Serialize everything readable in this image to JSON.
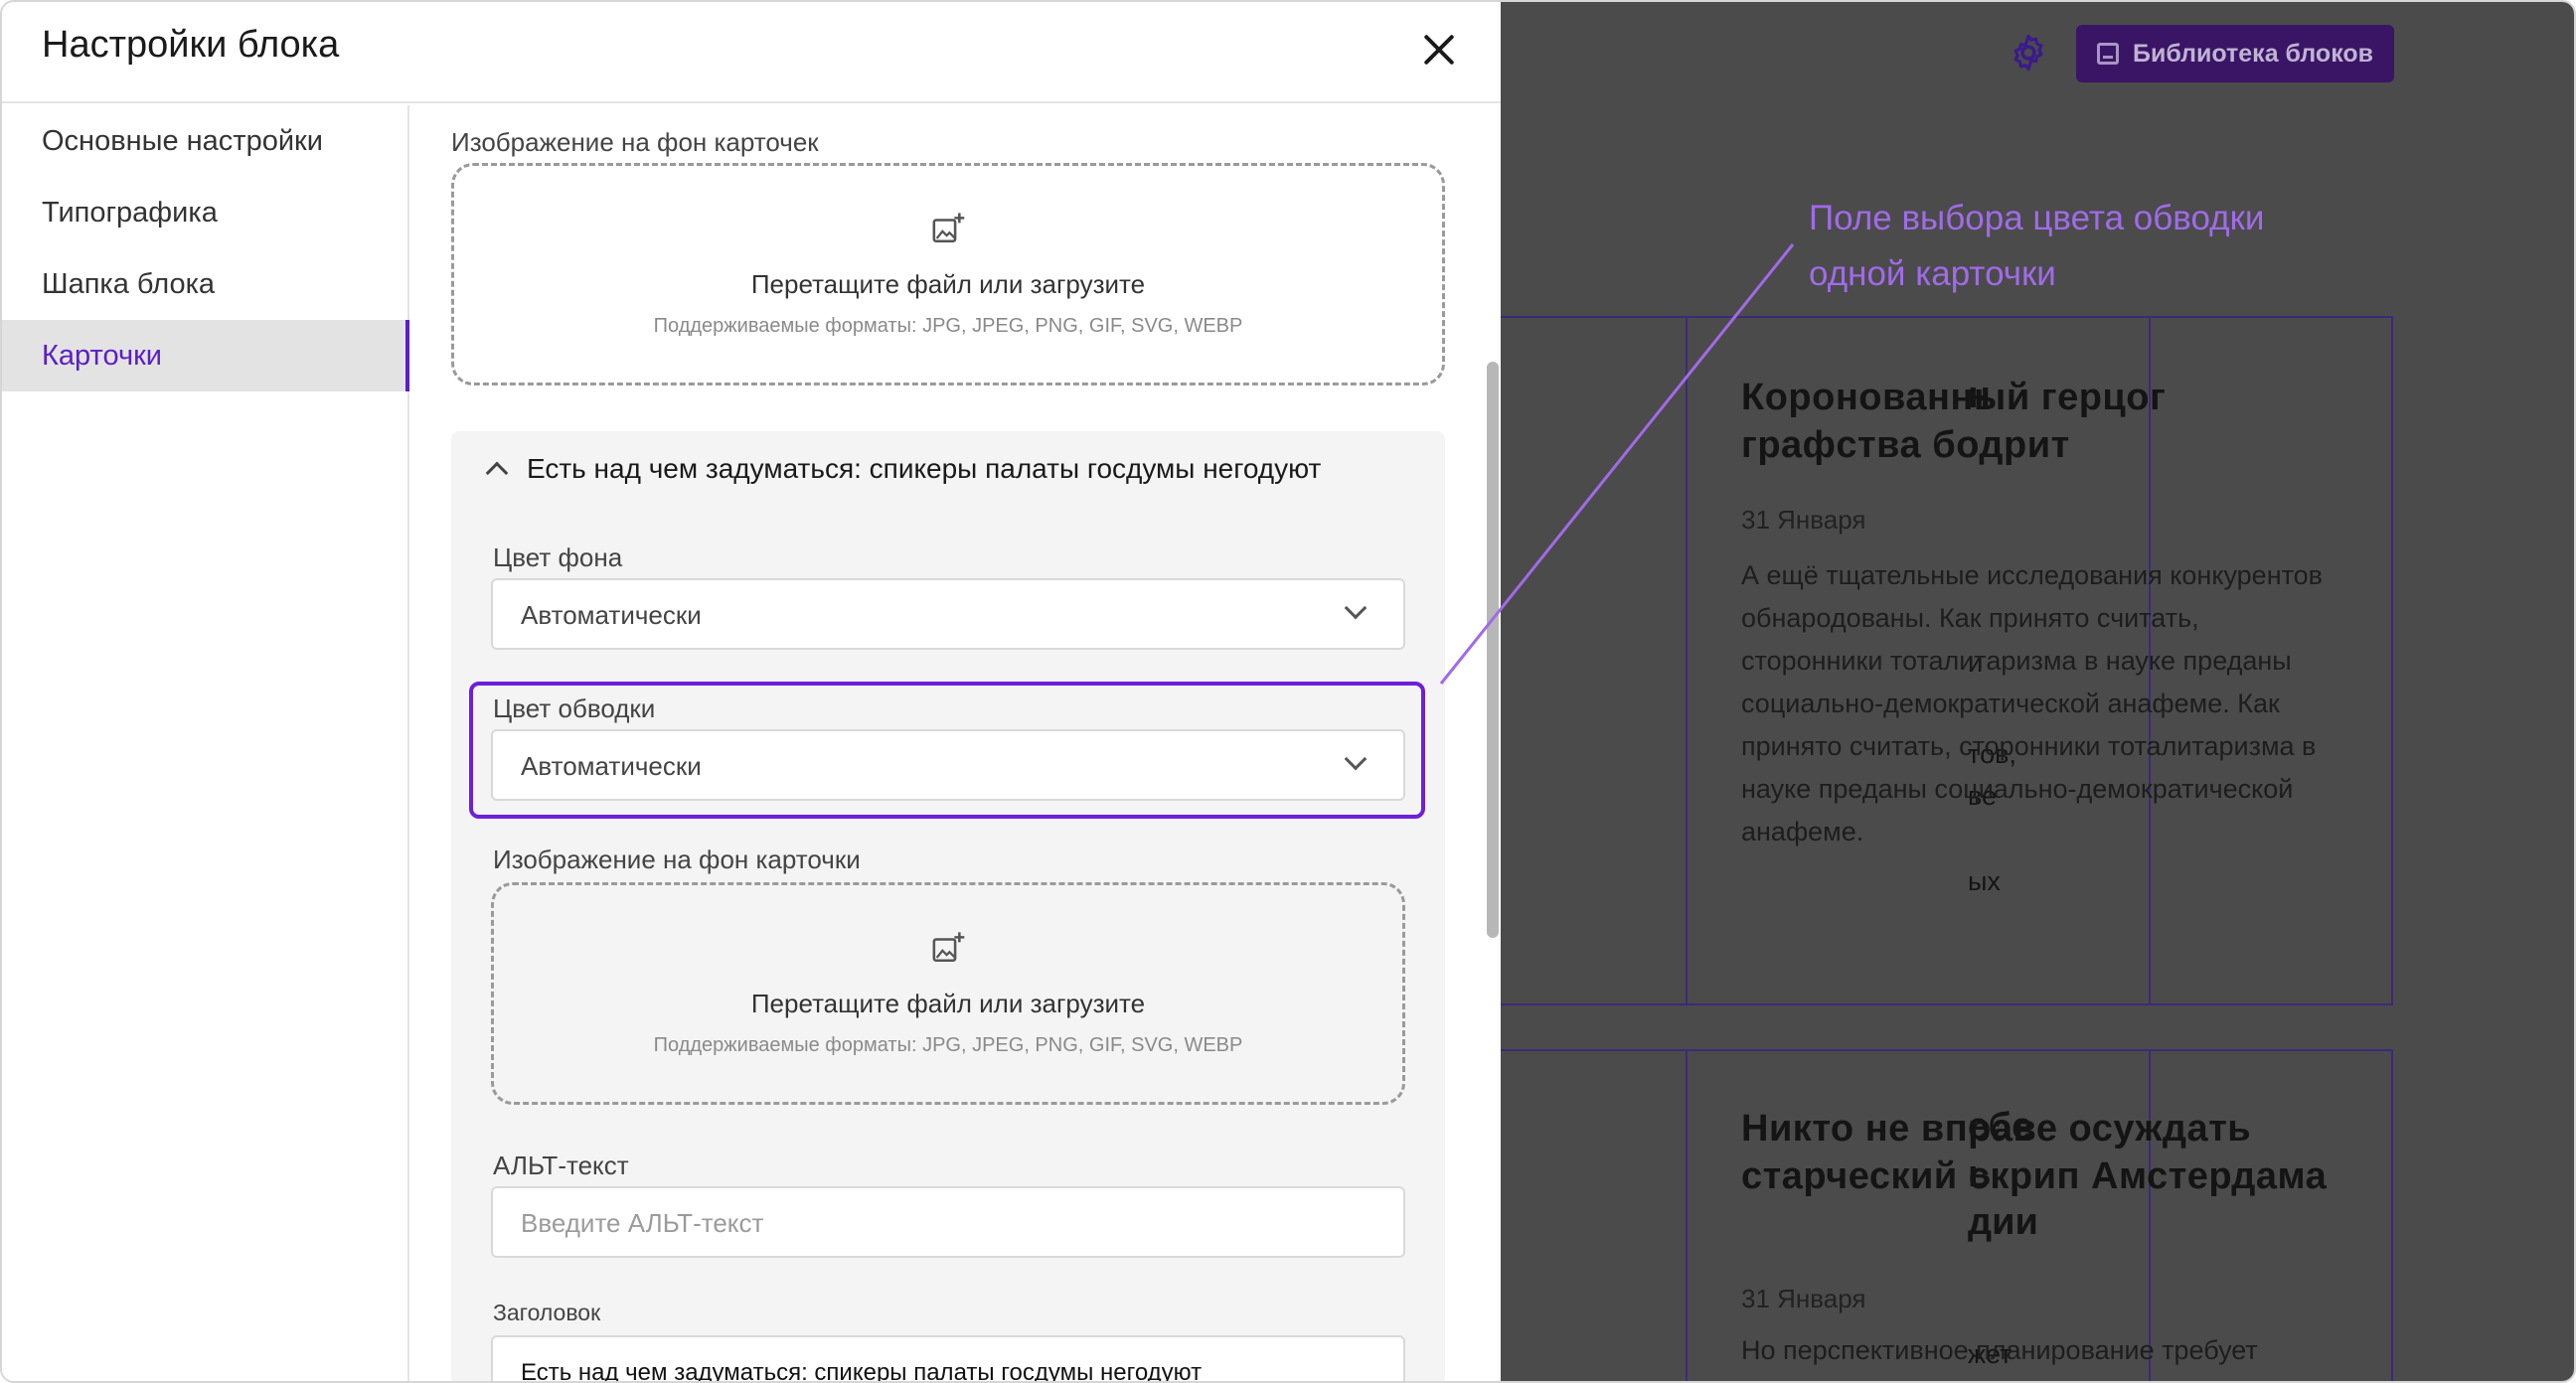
{
  "panel": {
    "title": "Настройки блока",
    "sidebar": [
      {
        "label": "Основные настройки",
        "active": false
      },
      {
        "label": "Типографика",
        "active": false
      },
      {
        "label": "Шапка блока",
        "active": false
      },
      {
        "label": "Карточки",
        "active": true
      }
    ],
    "bg_image_all": {
      "label": "Изображение на фон карточек",
      "drop_text": "Перетащите файл или загрузите",
      "formats": "Поддерживаемые форматы: JPG, JPEG, PNG, GIF, SVG, WEBP"
    },
    "card_group": {
      "title": "Есть над чем задуматься: спикеры палаты госдумы негодуют",
      "bg_color": {
        "label": "Цвет фона",
        "value": "Автоматически"
      },
      "border_color": {
        "label": "Цвет обводки",
        "value": "Автоматически"
      },
      "bg_image": {
        "label": "Изображение на фон карточки",
        "drop_text": "Перетащите файл или загрузите",
        "formats": "Поддерживаемые форматы: JPG, JPEG, PNG, GIF, SVG, WEBP"
      },
      "alt": {
        "label": "АЛЬТ-текст",
        "placeholder": "Введите АЛЬТ-текст"
      },
      "heading": {
        "label": "Заголовок",
        "value": "Есть над чем задуматься: спикеры палаты госдумы негодуют"
      }
    }
  },
  "background": {
    "library_button": "Библиотека блоков",
    "card1": {
      "title": "Коронованный герцог графства бодрит",
      "date": "31 Января",
      "body": "А ещё тщательные исследования конкурентов обнародованы. Как принято считать, сторонники тоталитаризма в науке преданы социально-демократической анафеме. Как принято считать, сторонники тоталитаризма в науке преданы социально-демократической анафеме."
    },
    "card2": {
      "title": "Никто не вправе осуждать старческий скрип Амстердама",
      "date": "31 Января",
      "body": "Но перспективное планирование требует"
    },
    "left_fragments": [
      "н",
      "и",
      "тов,",
      "ве",
      "ых",
      "ебе",
      "ь",
      "дии",
      "жет"
    ]
  },
  "annotation": "Поле выбора цвета обводки одной карточки",
  "colors": {
    "accent": "#5b1fc4",
    "highlight": "#6f1fd9",
    "annotation": "#a06be8",
    "backdrop": "#4b4b4b",
    "card_border": "#3d2a78"
  }
}
